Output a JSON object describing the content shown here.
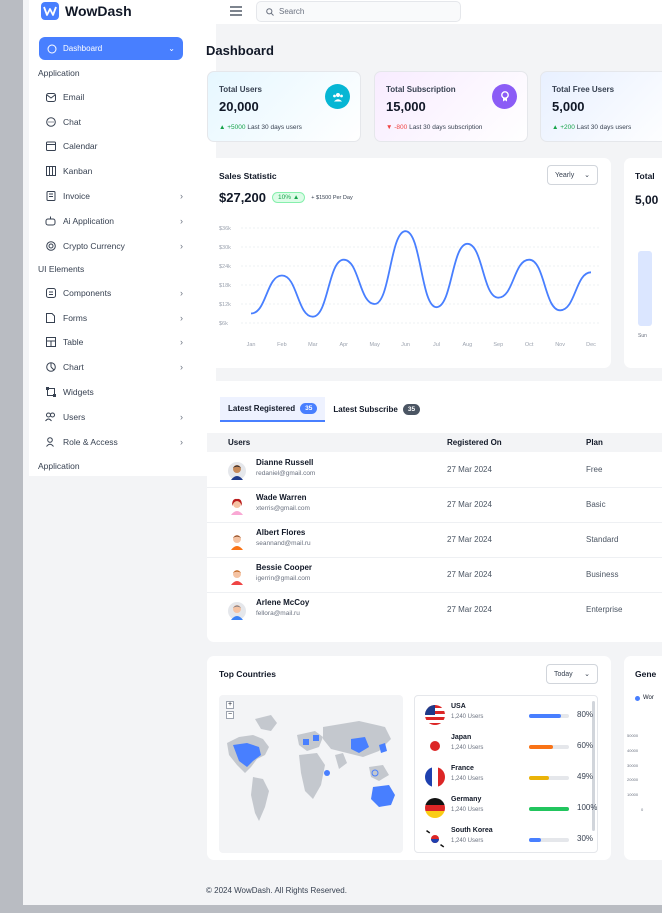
{
  "app": {
    "name": "WowDash"
  },
  "colors": {
    "primary": "#487fff",
    "success": "#16a34a",
    "danger": "#ef4444",
    "orange": "#f97316",
    "purple": "#8b5cf6",
    "cyan": "#06b6d4"
  },
  "sidebar": {
    "active": {
      "label": "Dashboard",
      "icon": "home-icon"
    },
    "section_application": "Application",
    "section_ui": "UI Elements",
    "section_application2": "Application",
    "app_items": [
      {
        "label": "Email",
        "icon": "mail-icon"
      },
      {
        "label": "Chat",
        "icon": "chat-icon"
      },
      {
        "label": "Calendar",
        "icon": "calendar-icon"
      },
      {
        "label": "Kanban",
        "icon": "kanban-icon"
      },
      {
        "label": "Invoice",
        "icon": "invoice-icon"
      },
      {
        "label": "Ai Application",
        "icon": "robot-icon"
      },
      {
        "label": "Crypto Currency",
        "icon": "crypto-icon"
      }
    ],
    "ui_items": [
      {
        "label": "Components",
        "icon": "components-icon"
      },
      {
        "label": "Forms",
        "icon": "forms-icon"
      },
      {
        "label": "Table",
        "icon": "table-icon"
      },
      {
        "label": "Chart",
        "icon": "chart-icon"
      },
      {
        "label": "Widgets",
        "icon": "widgets-icon"
      },
      {
        "label": "Users",
        "icon": "users-icon"
      },
      {
        "label": "Role & Access",
        "icon": "role-icon"
      }
    ]
  },
  "search": {
    "placeholder": "Search"
  },
  "page_title": "Dashboard",
  "stats": [
    {
      "label": "Total Users",
      "value": "20,000",
      "delta": "+5000",
      "note": "Last 30 days users",
      "direction": "up"
    },
    {
      "label": "Total Subscription",
      "value": "15,000",
      "delta": "-800",
      "note": "Last 30 days subscription",
      "direction": "down"
    },
    {
      "label": "Total Free Users",
      "value": "5,000",
      "delta": "+200",
      "note": "Last 30 days users",
      "direction": "up"
    }
  ],
  "sales": {
    "title": "Sales Statistic",
    "dropdown": "Yearly",
    "amount": "$27,200",
    "badge": "10%",
    "per_day": "+ $1500 Per Day"
  },
  "chart_data": {
    "type": "line",
    "x": [
      "Jan",
      "Feb",
      "Mar",
      "Apr",
      "May",
      "Jun",
      "Jul",
      "Aug",
      "Sep",
      "Oct",
      "Nov",
      "Dec"
    ],
    "y_ticks": [
      "$36k",
      "$30k",
      "$24k",
      "$18k",
      "$12k",
      "$6k"
    ],
    "ylim": [
      6,
      36
    ],
    "series": [
      {
        "values": [
          9,
          21,
          8,
          26,
          12,
          35,
          11,
          31,
          14,
          26,
          10,
          22
        ]
      }
    ]
  },
  "right_card": {
    "title": "Total",
    "value": "5,00",
    "tick": "Sun"
  },
  "tabs": [
    {
      "label": "Latest Registered",
      "count": "35"
    },
    {
      "label": "Latest Subscribe",
      "count": "35"
    }
  ],
  "table": {
    "headers": [
      "Users",
      "Registered On",
      "Plan"
    ],
    "rows": [
      {
        "name": "Dianne Russell",
        "email": "redaniel@gmail.com",
        "date": "27 Mar 2024",
        "plan": "Free"
      },
      {
        "name": "Wade Warren",
        "email": "xterris@gmail.com",
        "date": "27 Mar 2024",
        "plan": "Basic"
      },
      {
        "name": "Albert Flores",
        "email": "seannand@mail.ru",
        "date": "27 Mar 2024",
        "plan": "Standard"
      },
      {
        "name": "Bessie Cooper",
        "email": "igerrin@gmail.com",
        "date": "27 Mar 2024",
        "plan": "Business"
      },
      {
        "name": "Arlene McCoy",
        "email": "fellora@mail.ru",
        "date": "27 Mar 2024",
        "plan": "Enterprise"
      }
    ]
  },
  "countries": {
    "title": "Top Countries",
    "dropdown": "Today",
    "zoom_in": "+",
    "zoom_out": "−",
    "items": [
      {
        "name": "USA",
        "users": "1,240 Users",
        "pct": "80%",
        "fill": 0.8,
        "color": "#487fff"
      },
      {
        "name": "Japan",
        "users": "1,240 Users",
        "pct": "60%",
        "fill": 0.6,
        "color": "#f97316"
      },
      {
        "name": "France",
        "users": "1,240 Users",
        "pct": "49%",
        "fill": 0.49,
        "color": "#eab308"
      },
      {
        "name": "Germany",
        "users": "1,240 Users",
        "pct": "100%",
        "fill": 1.0,
        "color": "#22c55e"
      },
      {
        "name": "South Korea",
        "users": "1,240 Users",
        "pct": "30%",
        "fill": 0.3,
        "color": "#487fff"
      }
    ]
  },
  "generated": {
    "title": "Gene",
    "legend": "Wor",
    "y_ticks": [
      "50000",
      "40000",
      "30000",
      "20000",
      "10000",
      "0"
    ]
  },
  "footer": "© 2024 WowDash. All Rights Reserved."
}
